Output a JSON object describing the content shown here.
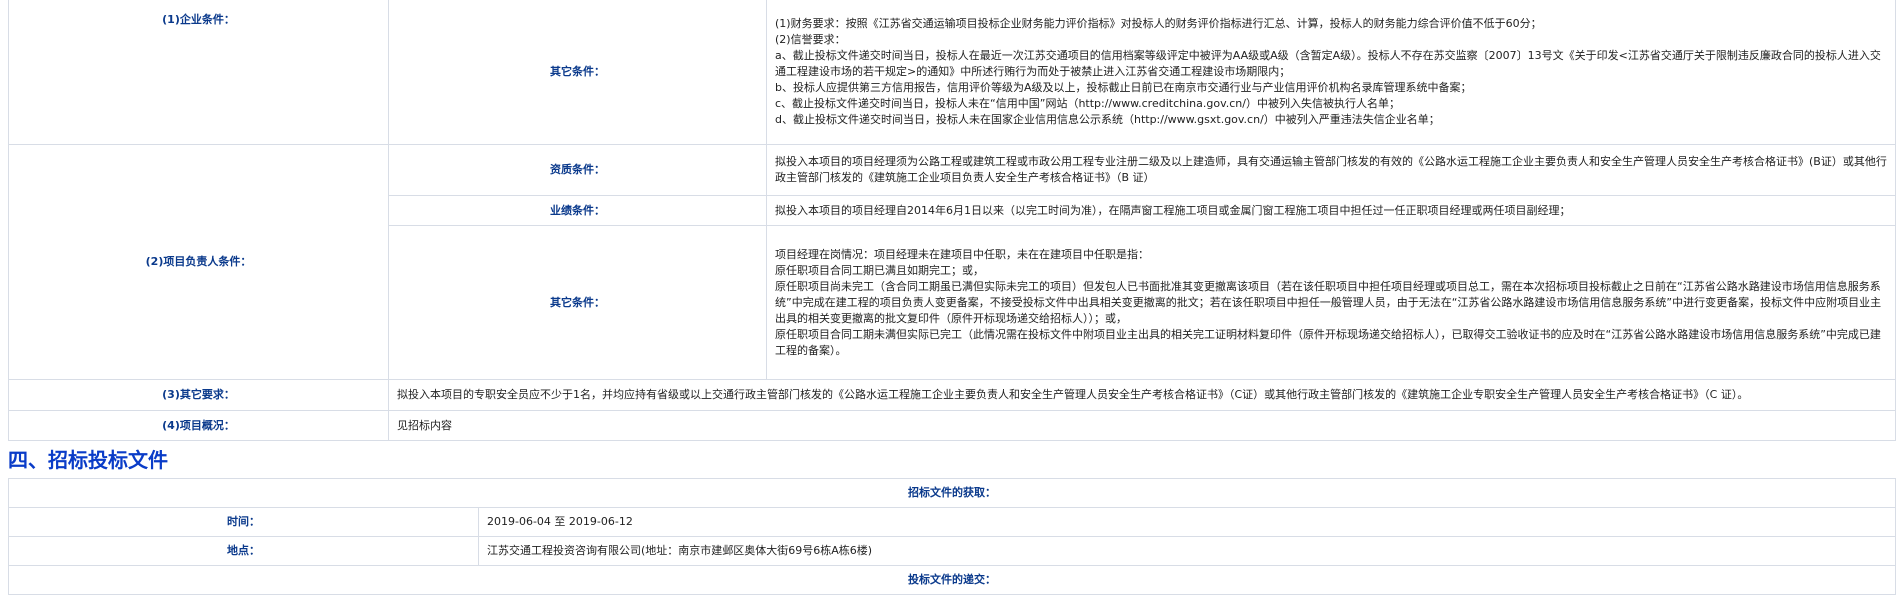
{
  "requirements": {
    "enterprise": {
      "label": "(1)企业条件：",
      "other_label": "其它条件：",
      "lines": [
        "(1)财务要求：按照《江苏省交通运输项目投标企业财务能力评价指标》对投标人的财务评价指标进行汇总、计算，投标人的财务能力综合评价值不低于60分；",
        "(2)信誉要求：",
        "a、截止投标文件递交时间当日，投标人在最近一次江苏交通项目的信用档案等级评定中被评为AA级或A级（含暂定A级）。投标人不存在苏交监察〔2007〕13号文《关于印发<江苏省交通厅关于限制违反廉政合同的投标人进入交通工程建设市场的若干规定>的通知》中所述行贿行为而处于被禁止进入江苏省交通工程建设市场期限内；",
        "b、投标人应提供第三方信用报告，信用评价等级为A级及以上，投标截止日前已在南京市交通行业与产业信用评价机构名录库管理系统中备案；",
        "c、截止投标文件递交时间当日，投标人未在“信用中国”网站（http://www.creditchina.gov.cn/）中被列入失信被执行人名单；",
        "d、截止投标文件递交时间当日，投标人未在国家企业信用信息公示系统（http://www.gsxt.gov.cn/）中被列入严重违法失信企业名单；"
      ]
    },
    "manager": {
      "label": "(2)项目负责人条件：",
      "qualification_label": "资质条件：",
      "qualification_text": "拟投入本项目的项目经理须为公路工程或建筑工程或市政公用工程专业注册二级及以上建造师，具有交通运输主管部门核发的有效的《公路水运工程施工企业主要负责人和安全生产管理人员安全生产考核合格证书》(B证）或其他行政主管部门核发的《建筑施工企业项目负责人安全生产考核合格证书》（B 证）",
      "performance_label": "业绩条件：",
      "performance_text": "拟投入本项目的项目经理自2014年6月1日以来（以完工时间为准），在隔声窗工程施工项目或金属门窗工程施工项目中担任过一任正职项目经理或两任项目副经理；",
      "other_label": "其它条件：",
      "other_lines": [
        "项目经理在岗情况：项目经理未在建项目中任职，未在在建项目中任职是指：",
        "原任职项目合同工期已满且如期完工；或，",
        "原任职项目尚未完工（含合同工期虽已满但实际未完工的项目）但发包人已书面批准其变更撤离该项目（若在该任职项目中担任项目经理或项目总工，需在本次招标项目投标截止之日前在“江苏省公路水路建设市场信用信息服务系统”中完成在建工程的项目负责人变更备案，不接受投标文件中出具相关变更撤离的批文；若在该任职项目中担任一般管理人员，由于无法在“江苏省公路水路建设市场信用信息服务系统”中进行变更备案，投标文件中应附项目业主出具的相关变更撤离的批文复印件（原件开标现场递交给招标人））；或，",
        "原任职项目合同工期未满但实际已完工（此情况需在投标文件中附项目业主出具的相关完工证明材料复印件（原件开标现场递交给招标人），已取得交工验收证书的应及时在“江苏省公路水路建设市场信用信息服务系统”中完成已建工程的备案）。"
      ]
    },
    "other": {
      "label": "(3)其它要求：",
      "text": "拟投入本项目的专职安全员应不少于1名，并均应持有省级或以上交通行政主管部门核发的《公路水运工程施工企业主要负责人和安全生产管理人员安全生产考核合格证书》（C证）或其他行政主管部门核发的《建筑施工企业专职安全生产管理人员安全生产考核合格证书》（C 证）。"
    },
    "overview": {
      "label": "(4)项目概况：",
      "text": "见招标内容"
    }
  },
  "section4": {
    "title": "四、招标投标文件",
    "obtain_header": "招标文件的获取：",
    "time_label": "时间：",
    "time_value": "2019-06-04 至 2019-06-12",
    "place_label": "地点：",
    "place_value": "江苏交通工程投资咨询有限公司(地址：南京市建邺区奥体大街69号6栋A栋6楼)",
    "submit_header": "投标文件的递交："
  }
}
